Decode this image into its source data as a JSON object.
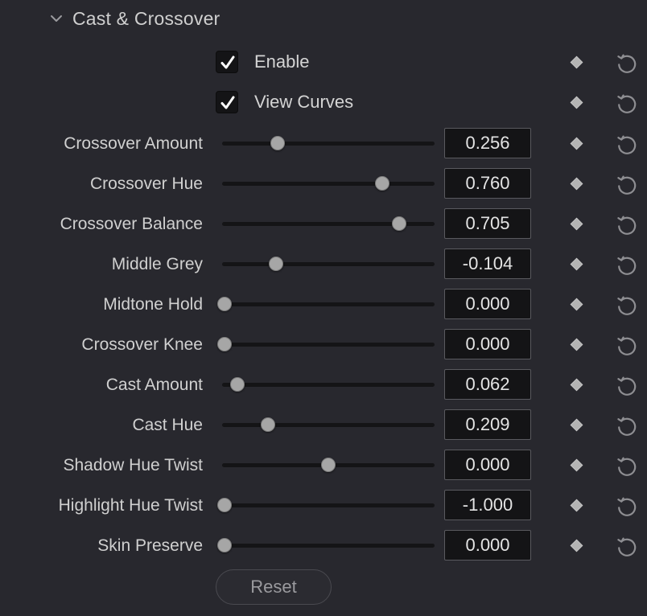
{
  "section": {
    "title": "Cast & Crossover",
    "collapse_icon": "chevron-down-icon"
  },
  "checkboxes": [
    {
      "label": "Enable",
      "checked": true
    },
    {
      "label": "View Curves",
      "checked": true
    }
  ],
  "params": [
    {
      "label": "Crossover Amount",
      "value": "0.256",
      "slider_fraction": 0.256
    },
    {
      "label": "Crossover Hue",
      "value": "0.760",
      "slider_fraction": 0.76
    },
    {
      "label": "Crossover Balance",
      "value": "0.705",
      "slider_fraction": 0.843
    },
    {
      "label": "Middle Grey",
      "value": "-0.104",
      "slider_fraction": 0.248
    },
    {
      "label": "Midtone Hold",
      "value": "0.000",
      "slider_fraction": 0.0
    },
    {
      "label": "Crossover Knee",
      "value": "0.000",
      "slider_fraction": 0.0
    },
    {
      "label": "Cast Amount",
      "value": "0.062",
      "slider_fraction": 0.062
    },
    {
      "label": "Cast Hue",
      "value": "0.209",
      "slider_fraction": 0.209
    },
    {
      "label": "Shadow Hue Twist",
      "value": "0.000",
      "slider_fraction": 0.5
    },
    {
      "label": "Highlight Hue Twist",
      "value": "-1.000",
      "slider_fraction": 0.0
    },
    {
      "label": "Skin Preserve",
      "value": "0.000",
      "slider_fraction": 0.0
    }
  ],
  "reset_button": {
    "label": "Reset"
  },
  "icons": {
    "keyframe": "keyframe-diamond-icon",
    "reset": "reset-arrow-icon",
    "check": "checkmark-icon"
  },
  "colors": {
    "background": "#28282e",
    "field": "#141416",
    "thumb": "#a6a6a6"
  }
}
